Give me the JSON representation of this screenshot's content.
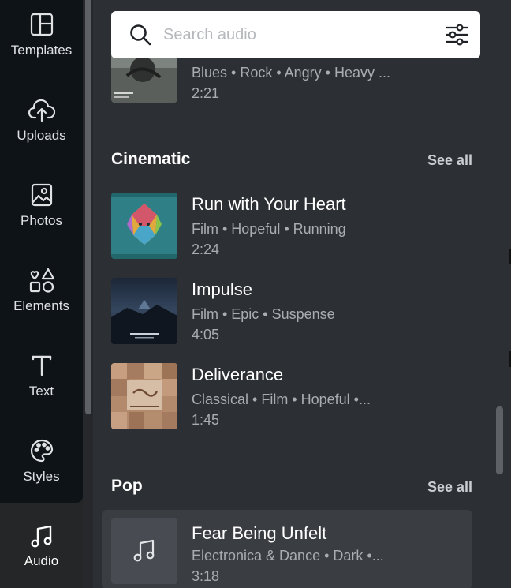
{
  "nav": {
    "items": [
      {
        "label": "Templates",
        "icon": "layout-icon"
      },
      {
        "label": "Uploads",
        "icon": "cloud-upload-icon"
      },
      {
        "label": "Photos",
        "icon": "image-icon"
      },
      {
        "label": "Elements",
        "icon": "shapes-icon"
      },
      {
        "label": "Text",
        "icon": "text-icon"
      },
      {
        "label": "Styles",
        "icon": "palette-icon"
      }
    ],
    "active": {
      "label": "Audio",
      "icon": "music-note-icon"
    }
  },
  "search": {
    "placeholder": "Search audio"
  },
  "partial_track": {
    "tags": "Blues • Rock • Angry • Heavy ...",
    "duration": "2:21"
  },
  "sections": [
    {
      "title": "Cinematic",
      "see_all": "See all",
      "tracks": [
        {
          "title": "Run with Your Heart",
          "tags": "Film • Hopeful • Running",
          "duration": "2:24"
        },
        {
          "title": "Impulse",
          "tags": "Film • Epic • Suspense",
          "duration": "4:05"
        },
        {
          "title": "Deliverance",
          "tags": "Classical • Film • Hopeful •...",
          "duration": "1:45"
        }
      ]
    },
    {
      "title": "Pop",
      "see_all": "See all",
      "tracks": [
        {
          "title": "Fear Being Unfelt",
          "tags": "Electronica & Dance • Dark •...",
          "duration": "3:18"
        }
      ]
    }
  ],
  "colors": {
    "nav_bg": "#0e1318",
    "panel_bg": "#2c2f33",
    "highlight": "#3a3d42",
    "muted_text": "#a9acb1"
  }
}
